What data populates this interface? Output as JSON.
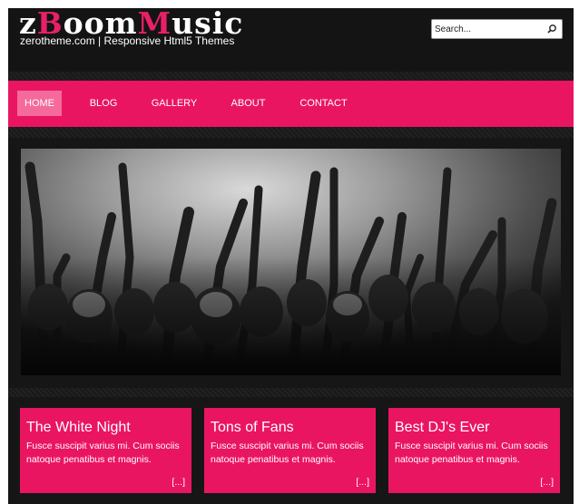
{
  "header": {
    "logo": {
      "part1": "z",
      "part2": "B",
      "part3": "oom",
      "part4": "M",
      "part5": "usic"
    },
    "tagline": "zerotheme.com | Responsive Html5 Themes",
    "search": {
      "placeholder": "Search...",
      "icon": "search-icon"
    }
  },
  "nav": {
    "items": [
      {
        "label": "HOME",
        "active": true
      },
      {
        "label": "BLOG"
      },
      {
        "label": "GALLERY"
      },
      {
        "label": "ABOUT"
      },
      {
        "label": "CONTACT"
      }
    ]
  },
  "hero": {
    "image": "concert-crowd-photo"
  },
  "features": [
    {
      "title": "The White Night",
      "text": "Fusce suscipit varius mi. Cum sociis natoque penatibus et magnis.",
      "more": "[...]"
    },
    {
      "title": "Tons of Fans",
      "text": "Fusce suscipit varius mi. Cum sociis natoque penatibus et magnis.",
      "more": "[...]"
    },
    {
      "title": "Best DJ's Ever",
      "text": "Fusce suscipit varius mi. Cum sociis natoque penatibus et magnis.",
      "more": "[...]"
    }
  ],
  "colors": {
    "accent": "#ea1561",
    "active_nav": "#f46a9a",
    "background": "#111111"
  }
}
